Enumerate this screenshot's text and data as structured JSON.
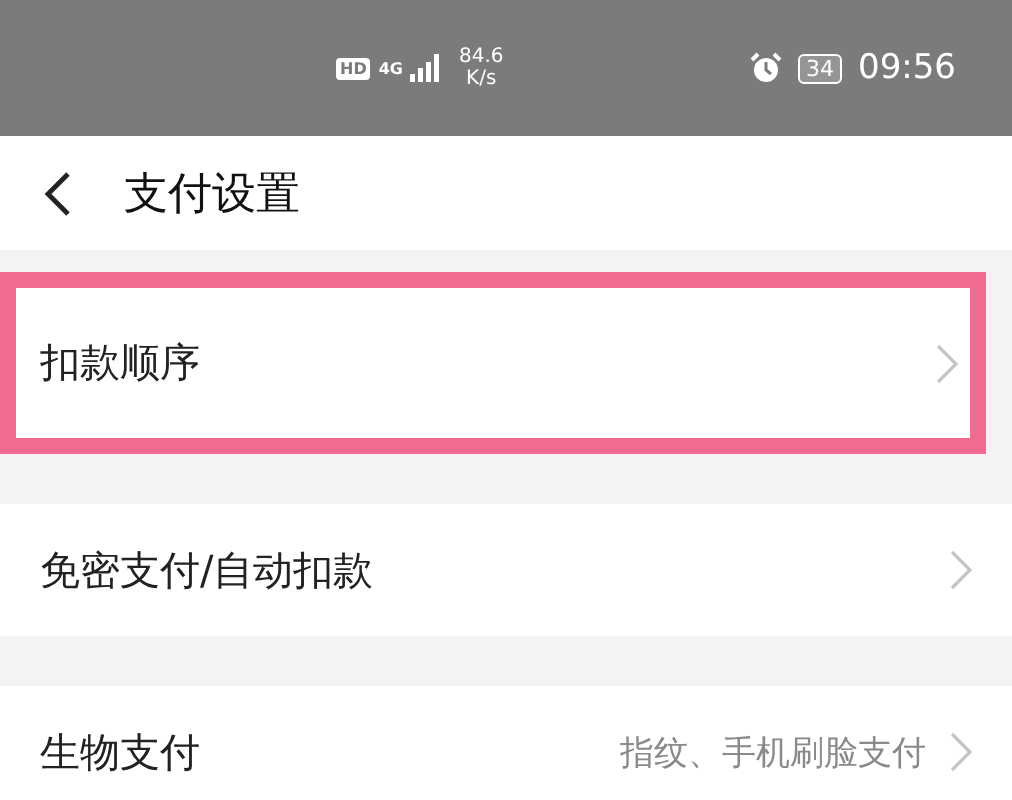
{
  "status_bar": {
    "hd": "HD",
    "network": "4G",
    "speed": "84.6",
    "speed_unit": "K/s",
    "battery": "34",
    "time": "09:56"
  },
  "header": {
    "title": "支付设置"
  },
  "items": [
    {
      "label": "扣款顺序",
      "highlighted": true
    },
    {
      "label": "免密支付/自动扣款",
      "highlighted": false
    },
    {
      "label": "生物支付",
      "value": "指纹、手机刷脸支付",
      "highlighted": false
    }
  ]
}
